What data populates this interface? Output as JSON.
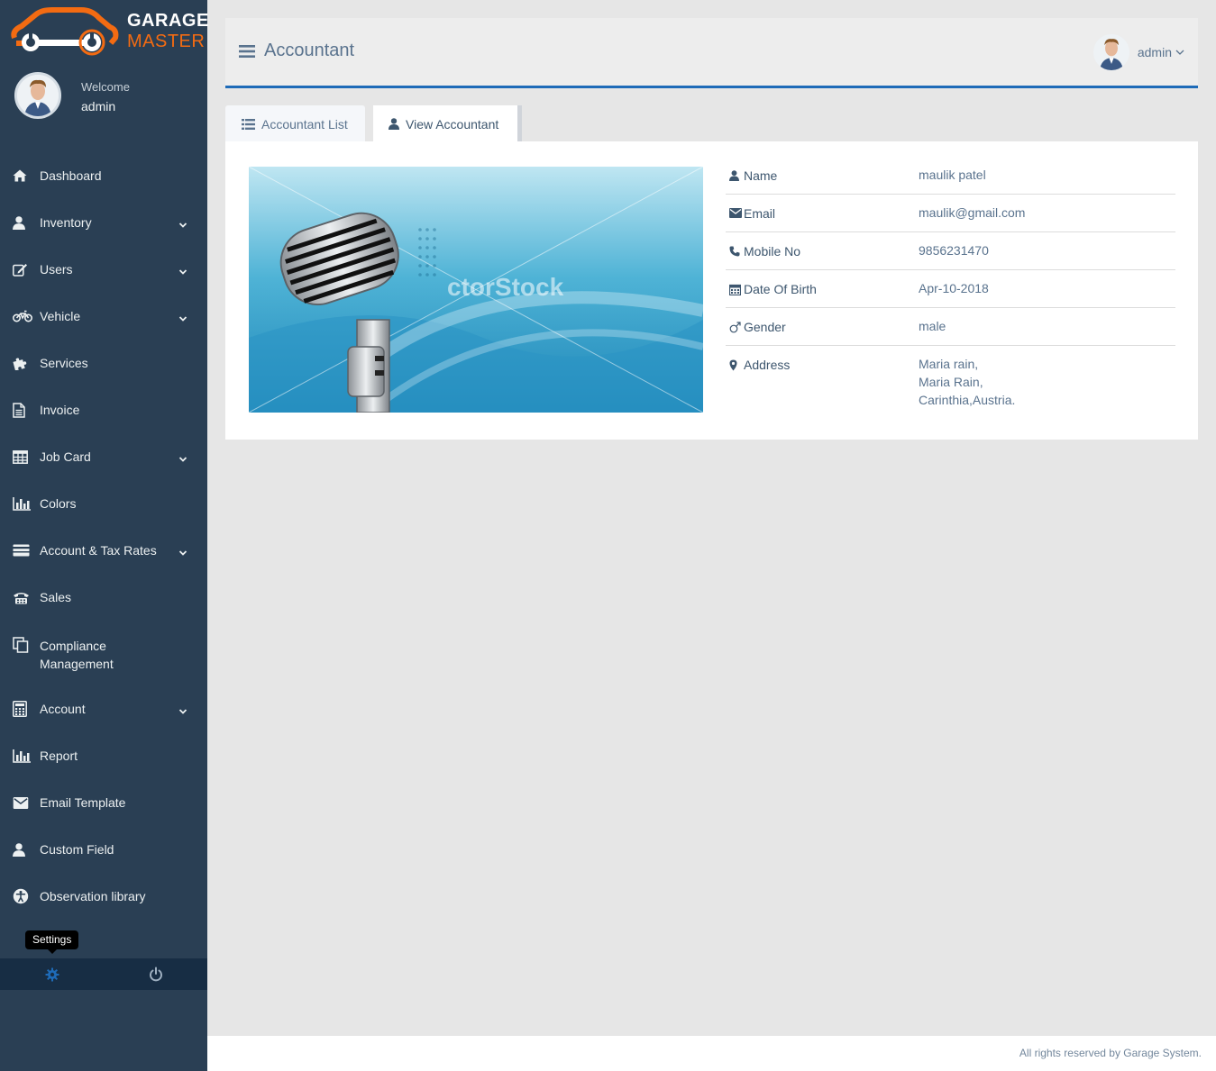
{
  "brand": {
    "line1": "GARAGE",
    "line2": "MASTER",
    "accent_color": "#f36b12",
    "sidebar_color": "#2a3f54"
  },
  "profile": {
    "welcome": "Welcome",
    "name": "admin"
  },
  "menu": [
    {
      "label": "Dashboard",
      "icon": "home-icon",
      "has_submenu": false
    },
    {
      "label": "Inventory",
      "icon": "user-icon",
      "has_submenu": true
    },
    {
      "label": "Users",
      "icon": "edit-icon",
      "has_submenu": true
    },
    {
      "label": "Vehicle",
      "icon": "motorcycle-icon",
      "has_submenu": true
    },
    {
      "label": "Services",
      "icon": "puzzle-icon",
      "has_submenu": false
    },
    {
      "label": "Invoice",
      "icon": "file-icon",
      "has_submenu": false
    },
    {
      "label": "Job Card",
      "icon": "table-icon",
      "has_submenu": true
    },
    {
      "label": "Colors",
      "icon": "bar-chart-icon",
      "has_submenu": false
    },
    {
      "label": "Account & Tax Rates",
      "icon": "credit-card-icon",
      "has_submenu": true
    },
    {
      "label": "Sales",
      "icon": "phone-icon",
      "has_submenu": false
    },
    {
      "label": "Compliance Management",
      "icon": "copy-icon",
      "has_submenu": false
    },
    {
      "label": "Account",
      "icon": "calculator-icon",
      "has_submenu": true
    },
    {
      "label": "Report",
      "icon": "bar-chart-icon",
      "has_submenu": false
    },
    {
      "label": "Email Template",
      "icon": "envelope-icon",
      "has_submenu": false
    },
    {
      "label": "Custom Field",
      "icon": "user-icon",
      "has_submenu": false
    },
    {
      "label": "Observation library",
      "icon": "universal-access-icon",
      "has_submenu": false
    }
  ],
  "sidebar_footer": {
    "tooltip": "Settings"
  },
  "header": {
    "title": "Accountant",
    "user": "admin"
  },
  "tabs": [
    {
      "label": "Accountant List",
      "icon": "list-icon",
      "active": false
    },
    {
      "label": "View Accountant",
      "icon": "user-icon",
      "active": true
    }
  ],
  "photo": {
    "watermark": "ctorStock"
  },
  "details": {
    "name_label": "Name",
    "name": "maulik patel",
    "email_label": "Email",
    "email": "maulik@gmail.com",
    "mobile_label": "Mobile No",
    "mobile": "9856231470",
    "dob_label": "Date Of Birth",
    "dob": "Apr-10-2018",
    "gender_label": "Gender",
    "gender": "male",
    "address_label": "Address",
    "address_lines": [
      "Maria rain,",
      "Maria Rain,",
      "Carinthia,Austria."
    ]
  },
  "footer": {
    "copyright": "All rights reserved by Garage System."
  }
}
